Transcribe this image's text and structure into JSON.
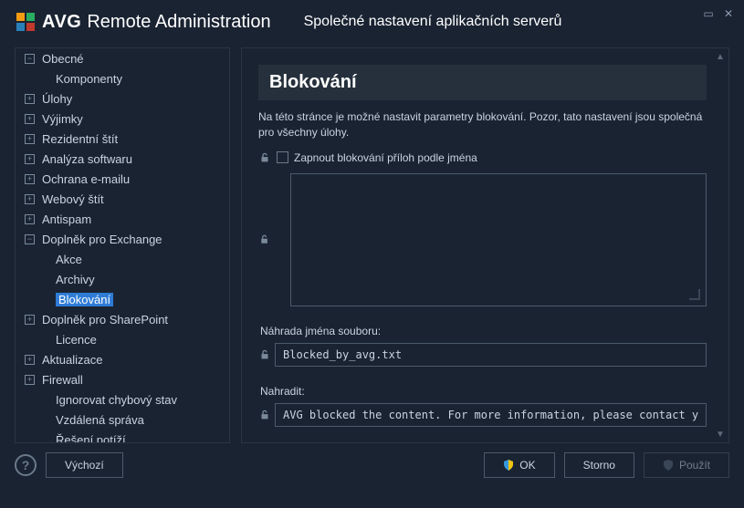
{
  "header": {
    "brand": "AVG",
    "product": "Remote Administration",
    "title": "Společné nastavení aplikačních serverů"
  },
  "sidebar": {
    "items": [
      {
        "label": "Obecné",
        "icon": "minus"
      },
      {
        "label": "Komponenty",
        "indent": true
      },
      {
        "label": "Úlohy",
        "icon": "plus"
      },
      {
        "label": "Výjimky",
        "icon": "plus"
      },
      {
        "label": "Rezidentní štít",
        "icon": "plus"
      },
      {
        "label": "Analýza softwaru",
        "icon": "plus"
      },
      {
        "label": "Ochrana e-mailu",
        "icon": "plus"
      },
      {
        "label": "Webový štít",
        "icon": "plus"
      },
      {
        "label": "Antispam",
        "icon": "plus"
      },
      {
        "label": "Doplněk pro Exchange",
        "icon": "minus"
      },
      {
        "label": "Akce",
        "indent": true
      },
      {
        "label": "Archivy",
        "indent": true
      },
      {
        "label": "Blokování",
        "indent": true,
        "selected": true
      },
      {
        "label": "Doplněk pro SharePoint",
        "icon": "plus"
      },
      {
        "label": "Licence",
        "indent": true
      },
      {
        "label": "Aktualizace",
        "icon": "plus"
      },
      {
        "label": "Firewall",
        "icon": "plus"
      },
      {
        "label": "Ignorovat chybový stav",
        "indent": true
      },
      {
        "label": "Vzdálená správa",
        "indent": true
      },
      {
        "label": "Řešení potíží",
        "indent": true
      }
    ]
  },
  "content": {
    "title": "Blokování",
    "description": "Na této stránce je možné nastavit parametry blokování. Pozor, tato nastavení jsou společná pro všechny úlohy.",
    "checkbox_label": "Zapnout blokování příloh podle jména",
    "filename_label": "Náhrada jména souboru:",
    "filename_value": "Blocked_by_avg.txt",
    "replace_label": "Nahradit:",
    "replace_value": "AVG blocked the content. For more information, please contact your system a"
  },
  "footer": {
    "default": "Výchozí",
    "ok": "OK",
    "cancel": "Storno",
    "apply": "Použít"
  }
}
